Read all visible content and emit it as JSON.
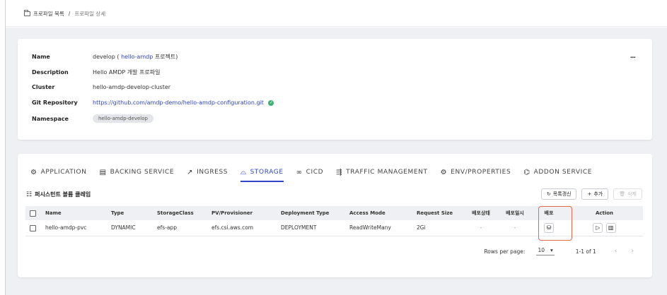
{
  "breadcrumb": {
    "root": "프로파일 목록",
    "separator": "/",
    "current": "프로파일 상세"
  },
  "profile": {
    "name_label": "Name",
    "name_prefix": "develop (",
    "name_link": "hello-amdp",
    "name_suffix": "프로젝트)",
    "description_label": "Description",
    "description": "Hello AMDP 개발 프로파일",
    "cluster_label": "Cluster",
    "cluster": "hello-amdp-develop-cluster",
    "git_label": "Git Repository",
    "git_url": "https://github.com/amdp-demo/hello-amdp-configuration.git",
    "namespace_label": "Namespace",
    "namespace": "hello-amdp-develop",
    "more": "..."
  },
  "tabs": [
    {
      "label": "APPLICATION",
      "icon": "⚙"
    },
    {
      "label": "BACKING SERVICE",
      "icon": "▤"
    },
    {
      "label": "INGRESS",
      "icon": "↗"
    },
    {
      "label": "STORAGE",
      "icon": "⌓"
    },
    {
      "label": "CICD",
      "icon": "∞"
    },
    {
      "label": "TRAFFIC MANAGEMENT",
      "icon": "⇶"
    },
    {
      "label": "ENV/PROPERTIES",
      "icon": "⚙"
    },
    {
      "label": "ADDON SERVICE",
      "icon": "⌬"
    }
  ],
  "section": {
    "title": "퍼시스턴트 볼륨 클레임",
    "refresh": "목록갱신",
    "add": "추가",
    "delete": "삭제"
  },
  "table": {
    "headers": [
      "Name",
      "Type",
      "StorageClass",
      "PV/Provisioner",
      "Deployment Type",
      "Access Mode",
      "Request Size",
      "배포상태",
      "배포일시",
      "배포",
      "Action"
    ],
    "rows": [
      {
        "name": "hello-amdp-pvc",
        "type": "DYNAMIC",
        "storage_class": "efs-app",
        "provisioner": "efs.csi.aws.com",
        "deployment_type": "DEPLOYMENT",
        "access_mode": "ReadWriteMany",
        "request_size": "2Gi",
        "deploy_status": "-",
        "deploy_time": "-"
      }
    ]
  },
  "pager": {
    "rows_per_page_label": "Rows per page:",
    "rows_per_page": "10",
    "range": "1-1 of 1"
  },
  "colors": {
    "accent": "#2f45c5",
    "highlight": "#e26a4a",
    "success": "#3bb273"
  }
}
